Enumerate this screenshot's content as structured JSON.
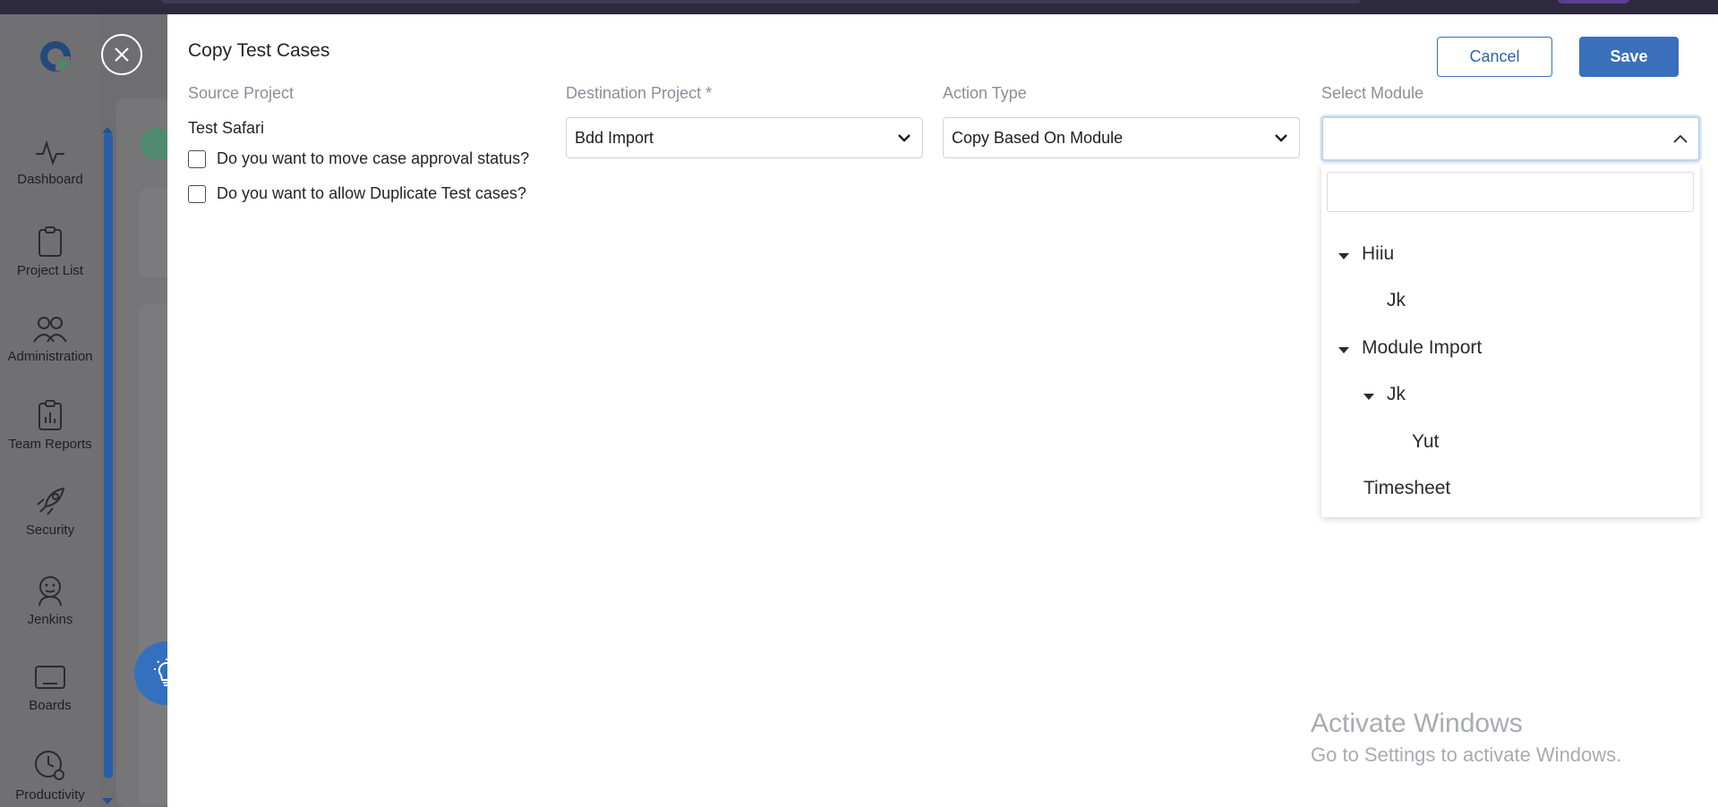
{
  "sidebar": {
    "items": [
      {
        "label": "Dashboard",
        "icon": "activity-icon"
      },
      {
        "label": "Project List",
        "icon": "clipboard-icon"
      },
      {
        "label": "Administration",
        "icon": "users-icon"
      },
      {
        "label": "Team Reports",
        "icon": "report-clipboard-icon"
      },
      {
        "label": "Security",
        "icon": "rocket-icon"
      },
      {
        "label": "Jenkins",
        "icon": "jenkins-icon"
      },
      {
        "label": "Boards",
        "icon": "board-icon"
      },
      {
        "label": "Productivity",
        "icon": "clock-gear-icon"
      }
    ]
  },
  "modal": {
    "title": "Copy Test Cases",
    "cancel_label": "Cancel",
    "save_label": "Save",
    "source_project": {
      "label": "Source Project",
      "value": "Test Safari"
    },
    "checkboxes": [
      {
        "label": "Do you want to move case approval status?",
        "checked": false
      },
      {
        "label": "Do you want to allow Duplicate Test cases?",
        "checked": false
      }
    ],
    "destination_project": {
      "label": "Destination Project *",
      "value": "Bdd Import"
    },
    "action_type": {
      "label": "Action Type",
      "value": "Copy Based On Module"
    },
    "select_module": {
      "label": "Select Module",
      "value": "",
      "search_placeholder": "",
      "tree": [
        {
          "label": "Hiiu",
          "expanded": true
        },
        {
          "label": "Jk"
        },
        {
          "label": "Module Import",
          "expanded": true
        },
        {
          "label": "Jk",
          "expanded": true
        },
        {
          "label": "Yut"
        },
        {
          "label": "Timesheet"
        }
      ]
    }
  },
  "watermark": {
    "line1": "Activate Windows",
    "line2": "Go to Settings to activate Windows."
  },
  "colors": {
    "primary": "#3a6fbb",
    "overlay": "#6e6e70",
    "label_gray": "#8b8e99"
  }
}
